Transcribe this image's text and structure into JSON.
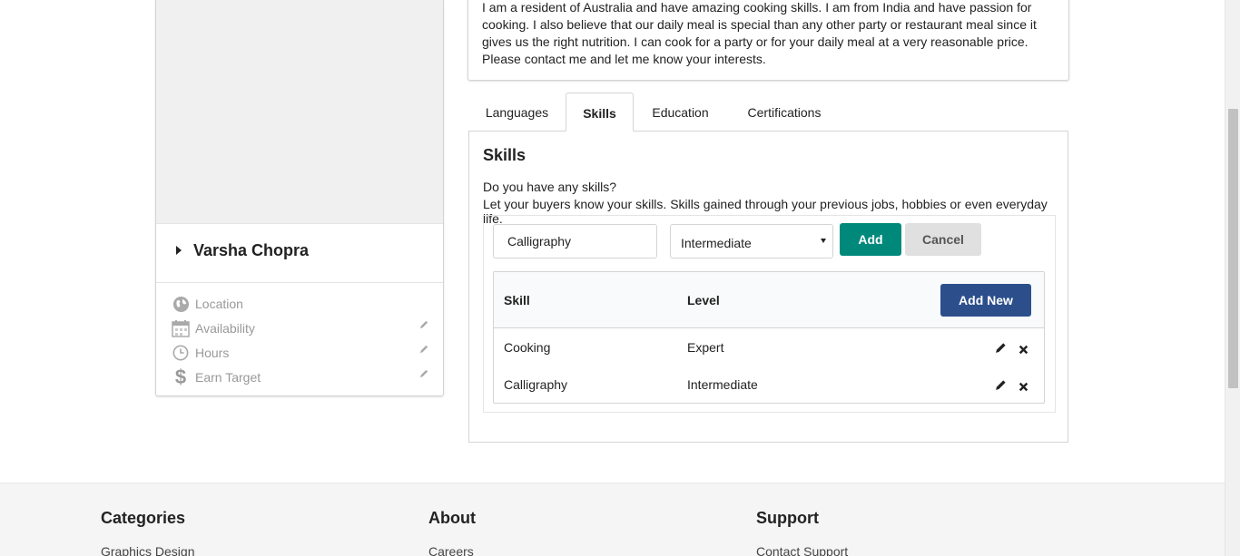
{
  "profile": {
    "name": "Varsha Chopra",
    "info": [
      {
        "label": "Location",
        "icon": "globe-icon",
        "editable": false
      },
      {
        "label": "Availability",
        "icon": "calendar-icon",
        "editable": true
      },
      {
        "label": "Hours",
        "icon": "clock-icon",
        "editable": true
      },
      {
        "label": "Earn Target",
        "icon": "dollar-icon",
        "editable": true
      }
    ]
  },
  "description": "I am a resident of Australia and have amazing cooking skills. I am from India and have passion for cooking. I also believe that our daily meal is special than any other party or restaurant meal since it gives us the right nutrition. I can cook for a party or for your daily meal at a very reasonable price. Please contact me and let me know your interests.",
  "tabs": [
    {
      "label": "Languages",
      "active": false
    },
    {
      "label": "Skills",
      "active": true
    },
    {
      "label": "Education",
      "active": false
    },
    {
      "label": "Certifications",
      "active": false
    }
  ],
  "skills": {
    "title": "Skills",
    "question": "Do you have any skills?",
    "hint": "Let your buyers know your skills. Skills gained through your previous jobs, hobbies or even everyday life.",
    "input_value": "Calligraphy",
    "level_value": "Intermediate",
    "add_label": "Add",
    "cancel_label": "Cancel",
    "table": {
      "headers": {
        "skill": "Skill",
        "level": "Level"
      },
      "add_new_label": "Add New",
      "rows": [
        {
          "skill": "Cooking",
          "level": "Expert"
        },
        {
          "skill": "Calligraphy",
          "level": "Intermediate"
        }
      ]
    }
  },
  "footer": {
    "columns": [
      {
        "title": "Categories",
        "first_link": "Graphics Design"
      },
      {
        "title": "About",
        "first_link": "Careers"
      },
      {
        "title": "Support",
        "first_link": "Contact Support"
      }
    ]
  },
  "colors": {
    "add_button": "#00897b",
    "add_new_button": "#2c4f8c",
    "cancel_button": "#e0e0e0"
  }
}
